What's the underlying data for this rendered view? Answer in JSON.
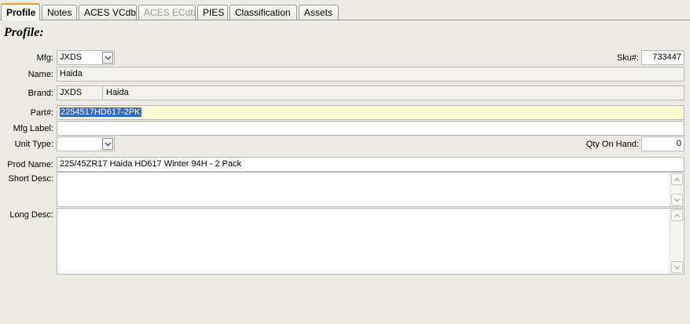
{
  "tabs": [
    "Profile",
    "Notes",
    "ACES VCdb",
    "ACES ECdb",
    "PIES",
    "Classification",
    "Assets"
  ],
  "section_title": "Profile:",
  "labels": {
    "mfg": "Mfg:",
    "sku": "Sku#:",
    "name": "Name:",
    "brand": "Brand:",
    "part": "Part#:",
    "mfg_label": "Mfg Label:",
    "unit_type": "Unit Type:",
    "qty_on_hand": "Qty On Hand:",
    "prod_name": "Prod Name:",
    "short_desc": "Short Desc:",
    "long_desc": "Long Desc:"
  },
  "values": {
    "mfg": "JXDS",
    "sku": "733447",
    "name": "Haida",
    "brand_code": "JXDS",
    "brand_name": "Haida",
    "part": "2254517HD617-2PK",
    "mfg_label": "",
    "unit_type": "",
    "qty_on_hand": "0",
    "prod_name": "225/45ZR17 Haida HD617 Winter 94H - 2 Pack",
    "short_desc": "",
    "long_desc": ""
  },
  "icons": {
    "dropdown": "chevron-down-icon",
    "scroll_up": "arrow-up-icon",
    "scroll_down": "arrow-down-icon"
  }
}
